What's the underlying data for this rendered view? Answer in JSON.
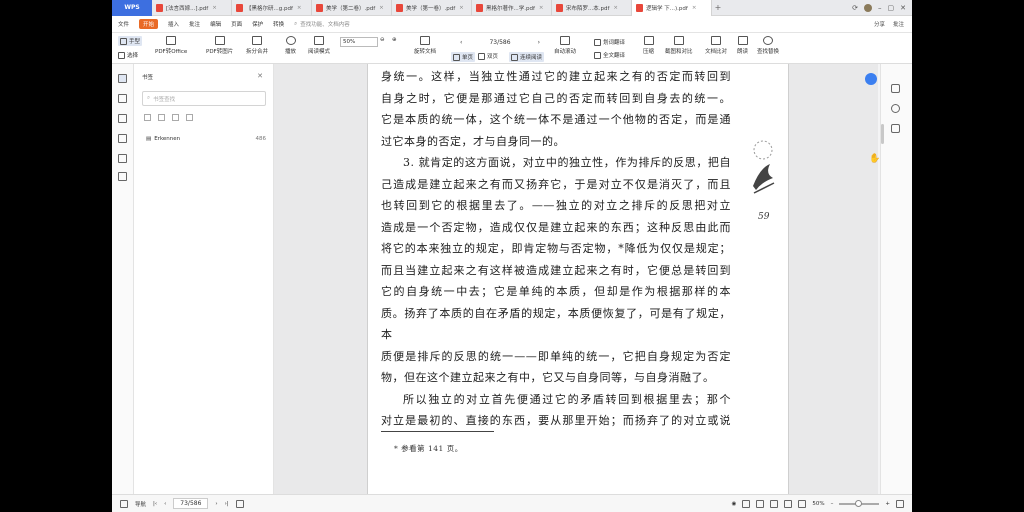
{
  "app": {
    "logo": "WPS"
  },
  "tabs": [
    {
      "label": "[法言西嫁...].pdf"
    },
    {
      "label": "【黑格尔研...g.pdf"
    },
    {
      "label": "美学（第二卷）.pdf"
    },
    {
      "label": "美学（第一卷）.pdf"
    },
    {
      "label": "黑格尔著作...学.pdf"
    },
    {
      "label": "宋布陌罗...本.pdf"
    },
    {
      "label": "逻辑学 下...).pdf",
      "active": true
    }
  ],
  "tabbar_right": {
    "share": "分享"
  },
  "menu": {
    "file": "文件",
    "items": [
      "开始",
      "插入",
      "批注",
      "编辑",
      "页面",
      "保护",
      "转换"
    ],
    "active": "开始",
    "search": "查找功能、文档内容",
    "right": [
      "分享",
      "批注"
    ]
  },
  "toolbar": {
    "hand": "手型",
    "select": "选择",
    "pdf_to_office": "PDF转Office",
    "pdf_to_image": "PDF转图片",
    "split_merge": "拆分合并",
    "play": "播放",
    "read_mode": "阅读模式",
    "zoom": "50%",
    "rotate": "旋转文档",
    "page_indicator": "73/586",
    "single": "单页",
    "double": "双页",
    "continuous": "连续阅读",
    "auto_scroll": "自动滚动",
    "translate_word": "划词翻译",
    "translate_full": "全文翻译",
    "compress": "压缩",
    "screenshot_compare": "截图和对比",
    "text_compare": "文档比对",
    "read_aloud": "朗读",
    "find_replace": "查找替换"
  },
  "bookmark_panel": {
    "title": "书签",
    "search_placeholder": "书签查找",
    "items": [
      {
        "label": "Erkennen",
        "page": "486"
      }
    ]
  },
  "document": {
    "paragraphs": [
      {
        "text": "身统一。这样，当独立性通过它的建立起来之有的否定而转回到",
        "indent": false,
        "last": false
      },
      {
        "text": "自身之时，它便是那通过它自己的否定而转回到自身去的统一。",
        "indent": false,
        "last": false
      },
      {
        "text": "它是本质的统一体，这个统一体不是通过一个他物的否定，而是通",
        "indent": false,
        "last": false
      },
      {
        "text": "过它本身的否定，才与自身同一的。",
        "indent": false,
        "last": true
      },
      {
        "text": "3. 就肯定的这方面说，对立中的独立性，作为排斥的反思，把自",
        "indent": true,
        "last": false
      },
      {
        "text": "己造成是建立起来之有而又扬弃它，于是对立不仅是消灭了，而且",
        "indent": false,
        "last": false
      },
      {
        "text": "也转回到它的根据里去了。——独立的对立之排斥的反思把对立",
        "indent": false,
        "last": false
      },
      {
        "text": "造成是一个否定物，造成仅仅是建立起来的东西；这种反思由此而",
        "indent": false,
        "last": false
      },
      {
        "text": "将它的本来独立的规定，即肯定物与否定物，*降低为仅仅是规定；",
        "indent": false,
        "last": false
      },
      {
        "text": "而且当建立起来之有这样被造成建立起来之有时，它便总是转回到",
        "indent": false,
        "last": false
      },
      {
        "text": "它的自身统一中去；它是单纯的本质，但却是作为根据那样的本",
        "indent": false,
        "last": false
      },
      {
        "text": "质。扬弃了本质的自在矛盾的规定，本质便恢复了，可是有了规定，本",
        "indent": false,
        "last": false
      },
      {
        "text": "质便是排斥的反思的统一——即单纯的统一，它把自身规定为否定",
        "indent": false,
        "last": false
      },
      {
        "text": "物，但在这个建立起来之有中，它又与自身同等，与自身消融了。",
        "indent": false,
        "last": true
      },
      {
        "text": "所以独立的对立首先便通过它的矛盾转回到根据里去；那个",
        "indent": true,
        "last": false
      },
      {
        "text": "对立是最初的、直接的东西，要从那里开始；而扬弃了的对立或说",
        "indent": false,
        "last": false
      }
    ],
    "footnote": "* 参看第 141 页。",
    "page_number": "59"
  },
  "statusbar": {
    "nav": "导航",
    "page": "73/586",
    "zoom": "50%"
  }
}
